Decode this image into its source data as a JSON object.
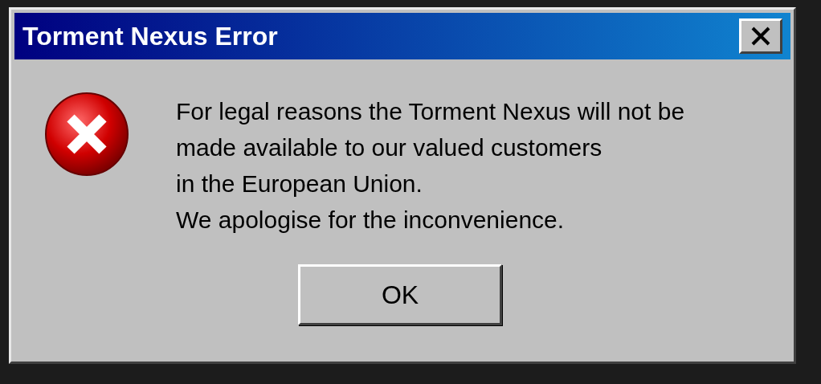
{
  "window": {
    "title": "Torment Nexus Error"
  },
  "message": "For legal reasons the Torment Nexus will not be\nmade available to our valued customers\nin the European Union.\nWe apologise for the inconvenience.",
  "buttons": [
    "OK"
  ]
}
